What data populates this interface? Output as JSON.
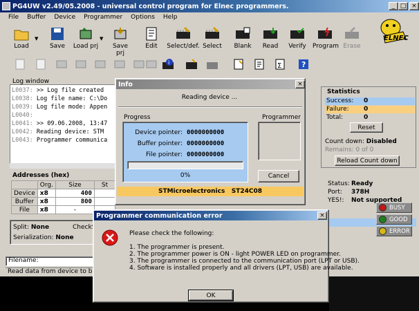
{
  "app": {
    "title": "PG4UW v2.49/05.2008 - universal control program for Elnec programmers.",
    "logo_text": "ELNEC"
  },
  "menu": [
    "File",
    "Buffer",
    "Device",
    "Programmer",
    "Options",
    "Help"
  ],
  "toolbar": [
    {
      "label": "Load",
      "icon": "load-icon"
    },
    {
      "label": "Save",
      "icon": "save-icon"
    },
    {
      "label": "Load prj",
      "icon": "load-project-icon"
    },
    {
      "label": "Save prj",
      "icon": "save-project-icon"
    },
    {
      "label": "Edit",
      "icon": "edit-icon"
    },
    {
      "label": "Select/def.",
      "icon": "select-default-icon"
    },
    {
      "label": "Select",
      "icon": "select-icon"
    },
    {
      "label": "Blank",
      "icon": "blank-icon"
    },
    {
      "label": "Read",
      "icon": "read-icon"
    },
    {
      "label": "Verify",
      "icon": "verify-icon"
    },
    {
      "label": "Program",
      "icon": "program-icon"
    },
    {
      "label": "Erase",
      "icon": "erase-icon"
    }
  ],
  "log": {
    "title": "Log window",
    "lines": [
      {
        "num": "L0037:",
        "text": ">> Log file created"
      },
      {
        "num": "L0038:",
        "text": "Log file name: C:\\Do"
      },
      {
        "num": "L0039:",
        "text": "Log file mode: Appen"
      },
      {
        "num": "L0040:",
        "text": ""
      },
      {
        "num": "L0041:",
        "text": ">> 09.06.2008, 13:47"
      },
      {
        "num": "L0042:",
        "text": "Reading device: STM"
      },
      {
        "num": "L0043:",
        "text": "Programmer communica"
      }
    ]
  },
  "addresses": {
    "title": "Addresses (hex)",
    "headers": [
      "",
      "Org.",
      "Size",
      "St"
    ],
    "rows": [
      {
        "name": "Device",
        "org": "x8",
        "size": "400"
      },
      {
        "name": "Buffer",
        "org": "x8",
        "size": "800"
      },
      {
        "name": "File",
        "org": "x8",
        "size": "-"
      }
    ],
    "split_label": "Split:",
    "split_value": "None",
    "checksum_label": "CheckS",
    "serialization_label": "Serialization:",
    "serialization_value": "None"
  },
  "filename_label": "Filename:",
  "status_line": "Read data from device to buffer",
  "statistics": {
    "title": "Statistics",
    "success_label": "Success:",
    "success_value": "0",
    "failure_label": "Failure:",
    "failure_value": "0",
    "total_label": "Total:",
    "total_value": "0",
    "reset_label": "Reset",
    "countdown_label": "Count down:",
    "countdown_value": "Disabled",
    "remains_label": "Remains:",
    "remains_value": "0 of 0",
    "reload_label": "Reload Count down",
    "status_label": "Status:",
    "status_value": "Ready",
    "port_label": "Port:",
    "port_value": "378H",
    "yes_label": "YES!:",
    "yes_value": "Not supported"
  },
  "info_dialog": {
    "title": "Info",
    "message": "Reading device ...",
    "progress_title": "Progress",
    "programmer_title": "Programmer",
    "device_pointer_label": "Device pointer:",
    "device_pointer_value": "0000000000",
    "buffer_pointer_label": "Buffer pointer:",
    "buffer_pointer_value": "0000000000",
    "file_pointer_label": "File pointer:",
    "file_pointer_value": "0000000000",
    "progress_percent": "0%",
    "progress_fraction": 0,
    "busy_label": "BUSY",
    "good_label": "GOOD",
    "error_label": "ERROR",
    "cancel_label": "Cancel",
    "device_name": "STMicroelectronics   ST24C08"
  },
  "error_dialog": {
    "title": "Programmer communication error",
    "intro": "Please check the following:",
    "items": [
      "1. The programmer is present.",
      "2. The programmer power is ON - light POWER LED on programmer.",
      "3. The programmer is connected to the communication port (LPT or USB).",
      "4. Software is installed properly and all drivers (LPT, USB) are available."
    ],
    "ok_label": "OK"
  },
  "colors": {
    "title_active": "#0a246a",
    "success_bg": "#a6caf0",
    "failure_bg": "#f8d080",
    "device_bar": "#f8c860",
    "error_red": "#d81818"
  }
}
